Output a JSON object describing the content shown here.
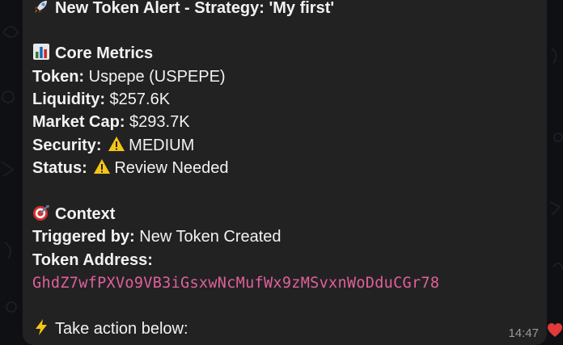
{
  "message": {
    "title": "New Token Alert - Strategy: 'My first'",
    "title_icon": "rocket-icon",
    "core_metrics": {
      "heading": "Core Metrics",
      "heading_icon": "bar-chart-icon",
      "token_label": "Token:",
      "token_value": "Uspepe (USPEPE)",
      "liquidity_label": "Liquidity:",
      "liquidity_value": "$257.6K",
      "market_cap_label": "Market Cap:",
      "market_cap_value": "$293.7K",
      "security_label": "Security:",
      "security_value": "MEDIUM",
      "security_icon": "warning-icon",
      "status_label": "Status:",
      "status_value": "Review Needed",
      "status_icon": "warning-icon"
    },
    "context": {
      "heading": "Context",
      "heading_icon": "target-icon",
      "triggered_label": "Triggered by:",
      "triggered_value": "New Token Created",
      "address_label": "Token Address:",
      "address_value": "GhdZ7wfPXVo9VB3iGsxwNcMufWx9zMSvxnWoDduCGr78"
    },
    "call_to_action": "Take action below:",
    "call_to_action_icon": "lightning-icon",
    "time": "14:47",
    "reaction_icon": "heart-icon"
  },
  "colors": {
    "bubble": "#222222",
    "background": "#0e1014",
    "text": "#f2f2f2",
    "address": "#e0609c",
    "time": "#9a9a9a",
    "reaction": "#e03a3a"
  }
}
